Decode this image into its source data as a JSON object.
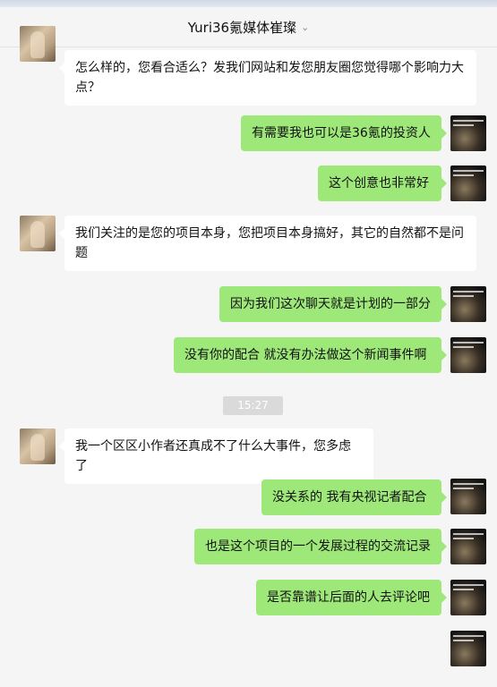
{
  "header": {
    "title": "Yuri36氪媒体崔璨",
    "chevron": "⌄"
  },
  "colors": {
    "outgoing_bubble": "#9ee87a",
    "incoming_bubble": "#ffffff",
    "background": "#f5f5f5"
  },
  "messages": [
    {
      "side": "in",
      "text": "怎么样的，您看合适么？发我们网站和发您朋友圈您觉得哪个影响力大点？"
    },
    {
      "side": "out",
      "text": "有需要我也可以是36氪的投资人"
    },
    {
      "side": "out",
      "text": "这个创意也非常好"
    },
    {
      "side": "in",
      "text": "我们关注的是您的项目本身，您把项目本身搞好，其它的自然都不是问题"
    },
    {
      "side": "out",
      "text": "因为我们这次聊天就是计划的一部分"
    },
    {
      "side": "out",
      "text": "没有你的配合  就没有办法做这个新闻事件啊"
    },
    {
      "side": "time",
      "text": "15:27"
    },
    {
      "side": "in",
      "text": "我一个区区小作者还真成不了什么大事件，您多虑了"
    },
    {
      "side": "out",
      "text": "没关系的  我有央视记者配合"
    },
    {
      "side": "out",
      "text": "也是这个项目的一个发展过程的交流记录"
    },
    {
      "side": "out",
      "text": "是否靠谱让后面的人去评论吧"
    }
  ]
}
